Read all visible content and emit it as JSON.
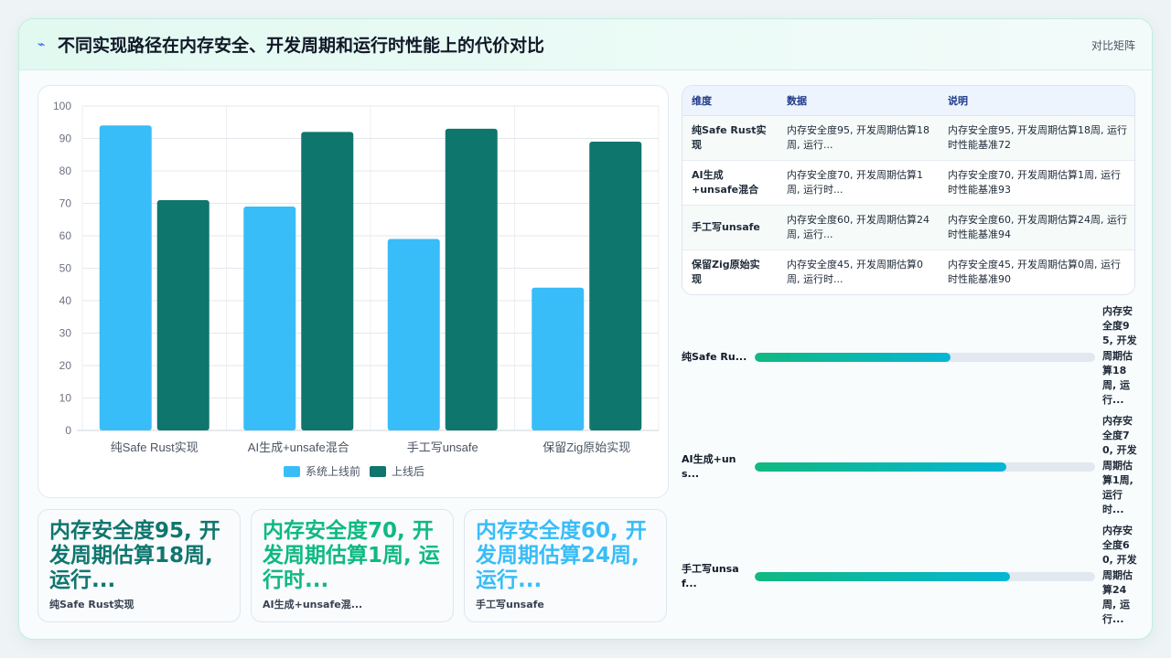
{
  "header": {
    "title": "不同实现路径在内存安全、开发周期和运行时性能上的代价对比",
    "tag": "对比矩阵",
    "accent": "#2563eb"
  },
  "chart_data": {
    "type": "bar",
    "categories": [
      "纯Safe Rust实现",
      "AI生成+unsafe混合",
      "手工写unsafe",
      "保留Zig原始实现"
    ],
    "series": [
      {
        "name": "系统上线前",
        "values": [
          94,
          69,
          59,
          44
        ],
        "color": "#38bdf8"
      },
      {
        "name": "上线后",
        "values": [
          71,
          92,
          93,
          89
        ],
        "color": "#0f766e"
      }
    ],
    "yticks": [
      "0",
      "10",
      "20",
      "30",
      "40",
      "50",
      "60",
      "70",
      "80",
      "90",
      "100"
    ],
    "ylim": [
      0,
      100
    ],
    "grid": true,
    "legend": "bottom"
  },
  "table": {
    "headers": [
      "维度",
      "数据",
      "说明"
    ],
    "rows": [
      [
        "纯Safe Rust实现",
        "内存安全度95, 开发周期估算18周, 运行...",
        "内存安全度95, 开发周期估算18周, 运行时性能基准72"
      ],
      [
        "AI生成+unsafe混合",
        "内存安全度70, 开发周期估算1周, 运行时...",
        "内存安全度70, 开发周期估算1周, 运行时性能基准93"
      ],
      [
        "手工写unsafe",
        "内存安全度60, 开发周期估算24周, 运行...",
        "内存安全度60, 开发周期估算24周, 运行时性能基准94"
      ],
      [
        "保留Zig原始实现",
        "内存安全度45, 开发周期估算0周, 运行时...",
        "内存安全度45, 开发周期估算0周, 运行时性能基准90"
      ]
    ]
  },
  "progress": [
    {
      "label": "纯Safe Ru...",
      "value_text": "内存安全度95, 开发周期估算18周, 运行...",
      "fraction": 0.575
    },
    {
      "label": "AI生成+uns...",
      "value_text": "内存安全度70, 开发周期估算1周, 运行时...",
      "fraction": 0.74
    },
    {
      "label": "手工写unsaf...",
      "value_text": "内存安全度60, 开发周期估算24周, 运行...",
      "fraction": 0.75
    }
  ],
  "kpis": [
    {
      "value": "内存安全度95, 开发周期估算18周, 运行...",
      "caption": "纯Safe Rust实现",
      "color": "#0f766e"
    },
    {
      "value": "内存安全度70, 开发周期估算1周, 运行时...",
      "caption": "AI生成+unsafe混...",
      "color": "#10b981"
    },
    {
      "value": "内存安全度60, 开发周期估算24周, 运行...",
      "caption": "手工写unsafe",
      "color": "#38bdf8"
    }
  ]
}
